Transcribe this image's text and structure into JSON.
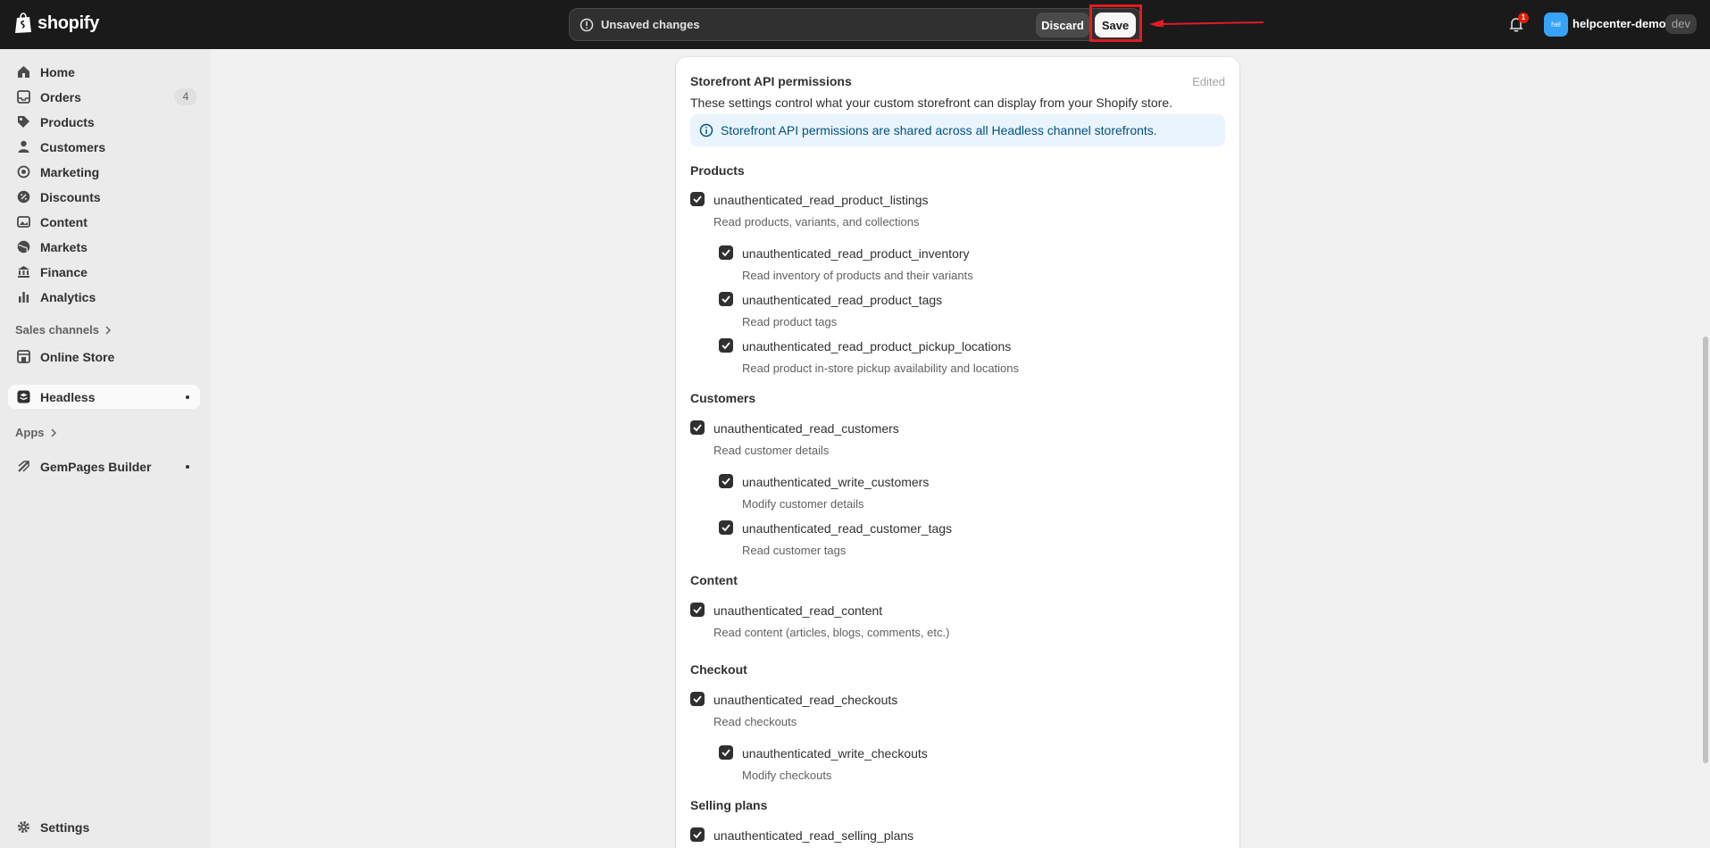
{
  "topbar": {
    "logo_text": "shopify",
    "unsaved_message": "Unsaved changes",
    "discard_label": "Discard",
    "save_label": "Save",
    "notification_count": "1",
    "store_initials": "hel",
    "store_name": "helpcenter-demo",
    "store_badge": "dev"
  },
  "sidebar": {
    "items": [
      {
        "label": "Home",
        "icon": "home-icon"
      },
      {
        "label": "Orders",
        "icon": "orders-icon",
        "count": "4"
      },
      {
        "label": "Products",
        "icon": "tag-icon"
      },
      {
        "label": "Customers",
        "icon": "person-icon"
      },
      {
        "label": "Marketing",
        "icon": "target-icon"
      },
      {
        "label": "Discounts",
        "icon": "discount-icon"
      },
      {
        "label": "Content",
        "icon": "image-icon"
      },
      {
        "label": "Markets",
        "icon": "globe-icon"
      },
      {
        "label": "Finance",
        "icon": "bank-icon"
      },
      {
        "label": "Analytics",
        "icon": "chart-bar-icon"
      }
    ],
    "sales_channels_header": "Sales channels",
    "online_store_label": "Online Store",
    "headless_label": "Headless",
    "apps_header": "Apps",
    "gempages_label": "GemPages Builder",
    "settings_label": "Settings"
  },
  "card": {
    "title": "Storefront API permissions",
    "status": "Edited",
    "description": "These settings control what your custom storefront can display from your Shopify store.",
    "banner": "Storefront API permissions are shared across all Headless channel storefronts.",
    "groups": {
      "products": "Products",
      "customers": "Customers",
      "content": "Content",
      "checkout": "Checkout",
      "selling_plans": "Selling plans"
    },
    "perms": {
      "p1": {
        "name": "unauthenticated_read_product_listings",
        "desc": "Read products, variants, and collections",
        "checked": true
      },
      "p2": {
        "name": "unauthenticated_read_product_inventory",
        "desc": "Read inventory of products and their variants",
        "checked": true
      },
      "p3": {
        "name": "unauthenticated_read_product_tags",
        "desc": "Read product tags",
        "checked": true
      },
      "p4": {
        "name": "unauthenticated_read_product_pickup_locations",
        "desc": "Read product in-store pickup availability and locations",
        "checked": true
      },
      "c1": {
        "name": "unauthenticated_read_customers",
        "desc": "Read customer details",
        "checked": true
      },
      "c2": {
        "name": "unauthenticated_write_customers",
        "desc": "Modify customer details",
        "checked": true
      },
      "c3": {
        "name": "unauthenticated_read_customer_tags",
        "desc": "Read customer tags",
        "checked": true
      },
      "ct1": {
        "name": "unauthenticated_read_content",
        "desc": "Read content (articles, blogs, comments, etc.)",
        "checked": true
      },
      "ck1": {
        "name": "unauthenticated_read_checkouts",
        "desc": "Read checkouts",
        "checked": true
      },
      "ck2": {
        "name": "unauthenticated_write_checkouts",
        "desc": "Modify checkouts",
        "checked": true
      },
      "s1": {
        "name": "unauthenticated_read_selling_plans",
        "checked": true
      }
    }
  },
  "colors": {
    "topbar_bg": "#1a1a1a",
    "highlight": "#e11b22",
    "banner_bg": "#eaf4ff",
    "banner_text": "#00527c"
  }
}
